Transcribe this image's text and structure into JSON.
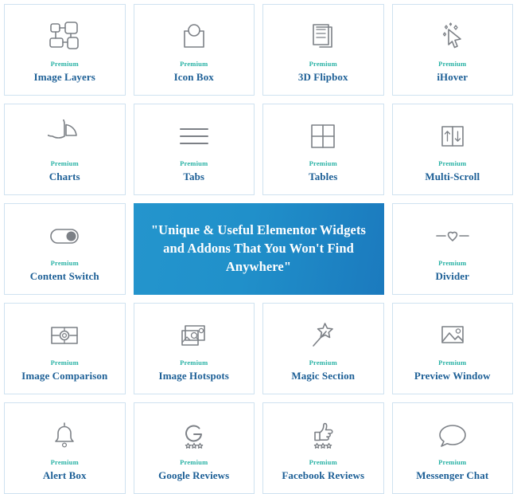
{
  "grid": {
    "badge_color": "#29b2a5",
    "title_color": "#1c5f96",
    "border_color": "#cfe2f0",
    "icon_color": "#7c8086",
    "banner_gradient_from": "#2495cd",
    "banner_gradient_to": "#1b7abe"
  },
  "banner": {
    "quote": "\"Unique & Useful Elementor Widgets and Addons That You Won't Find Anywhere\""
  },
  "cards": [
    {
      "badge": "Premium",
      "title": "Image Layers",
      "icon": "image-layers-icon"
    },
    {
      "badge": "Premium",
      "title": "Icon Box",
      "icon": "icon-box-icon"
    },
    {
      "badge": "Premium",
      "title": "3D Flipbox",
      "icon": "flipbox-pages-icon"
    },
    {
      "badge": "Premium",
      "title": "iHover",
      "icon": "cursor-sparkle-icon"
    },
    {
      "badge": "Premium",
      "title": "Charts",
      "icon": "pie-chart-icon"
    },
    {
      "badge": "Premium",
      "title": "Tabs",
      "icon": "hamburger-lines-icon"
    },
    {
      "badge": "Premium",
      "title": "Tables",
      "icon": "table-grid-icon"
    },
    {
      "badge": "Premium",
      "title": "Multi-Scroll",
      "icon": "up-down-arrows-icon"
    },
    {
      "badge": "Premium",
      "title": "Content Switch",
      "icon": "toggle-switch-icon"
    },
    {
      "badge": "Premium",
      "title": "Divider",
      "icon": "heart-divider-icon"
    },
    {
      "badge": "Premium",
      "title": "Image Comparison",
      "icon": "image-compare-icon"
    },
    {
      "badge": "Premium",
      "title": "Image Hotspots",
      "icon": "image-hotspots-icon"
    },
    {
      "badge": "Premium",
      "title": "Magic Section",
      "icon": "magic-wand-icon"
    },
    {
      "badge": "Premium",
      "title": "Preview Window",
      "icon": "picture-frame-icon"
    },
    {
      "badge": "Premium",
      "title": "Alert Box",
      "icon": "bell-icon"
    },
    {
      "badge": "Premium",
      "title": "Google Reviews",
      "icon": "google-g-stars-icon"
    },
    {
      "badge": "Premium",
      "title": "Facebook Reviews",
      "icon": "thumbs-up-stars-icon"
    },
    {
      "badge": "Premium",
      "title": "Messenger Chat",
      "icon": "chat-bubble-icon"
    }
  ]
}
